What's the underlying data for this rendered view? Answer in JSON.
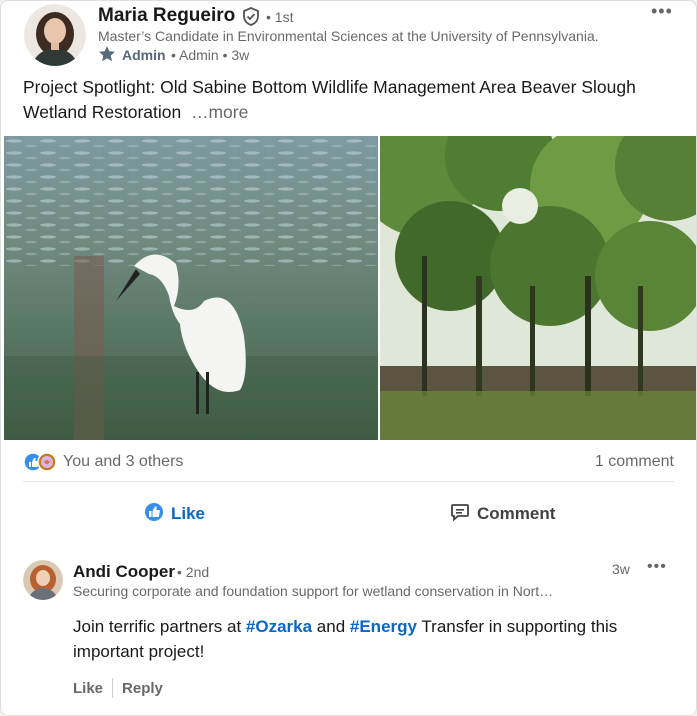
{
  "post": {
    "author": {
      "name": "Maria Regueiro",
      "degree": "• 1st",
      "headline": "Master’s Candidate in Environmental Sciences at the University of Pennsylvania.",
      "role_label": "Admin",
      "meta": "• Admin • 3w"
    },
    "text_main": "Project Spotlight: Old Sabine Bottom Wildlife Management Area Beaver Slough Wetland Restoration",
    "text_more": "…more",
    "images": [
      "egret-photo",
      "forest-wetland-photo"
    ]
  },
  "stats": {
    "reactions": "You and 3 others",
    "comments": "1 comment"
  },
  "actions": {
    "like": "Like",
    "comment": "Comment"
  },
  "comment": {
    "author": {
      "name": "Andi Cooper",
      "degree": "• 2nd",
      "headline": "Securing corporate and foundation support for wetland conservation in Nort…",
      "time": "3w"
    },
    "text_before": "Join terrific partners at ",
    "hashtag1": "#Ozarka",
    "text_mid": " and ",
    "hashtag2": "#Energy",
    "text_after": " Transfer in supporting this important project!",
    "actions": {
      "like": "Like",
      "reply": "Reply"
    }
  },
  "colors": {
    "accent": "#0a66c2",
    "muted": "#666666"
  }
}
